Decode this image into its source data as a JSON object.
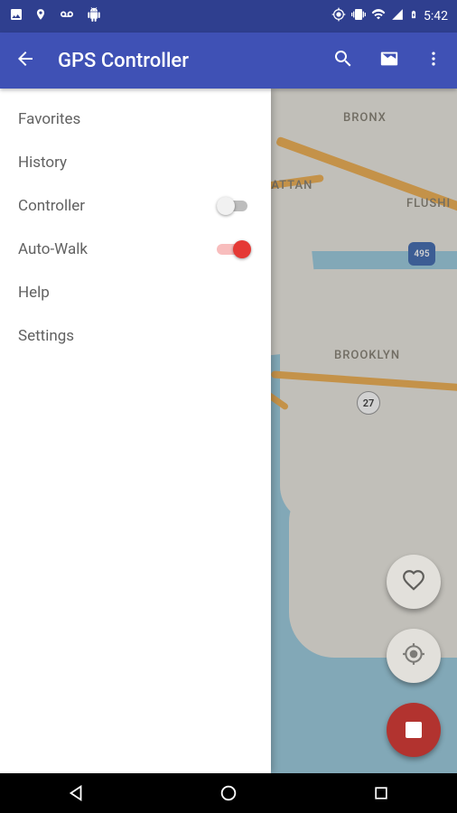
{
  "status": {
    "time": "5:42"
  },
  "appbar": {
    "title": "GPS Controller"
  },
  "drawer": {
    "items": [
      {
        "label": "Favorites",
        "toggle": null
      },
      {
        "label": "History",
        "toggle": null
      },
      {
        "label": "Controller",
        "toggle": "off"
      },
      {
        "label": "Auto-Walk",
        "toggle": "on"
      },
      {
        "label": "Help",
        "toggle": null
      },
      {
        "label": "Settings",
        "toggle": null
      }
    ]
  },
  "map": {
    "labels": {
      "bronx": "BRONX",
      "hattan": "HATTAN",
      "flushi": "FLUSHI",
      "brooklyn": "BROOKLYN"
    },
    "route27": "27",
    "route495": "495"
  }
}
